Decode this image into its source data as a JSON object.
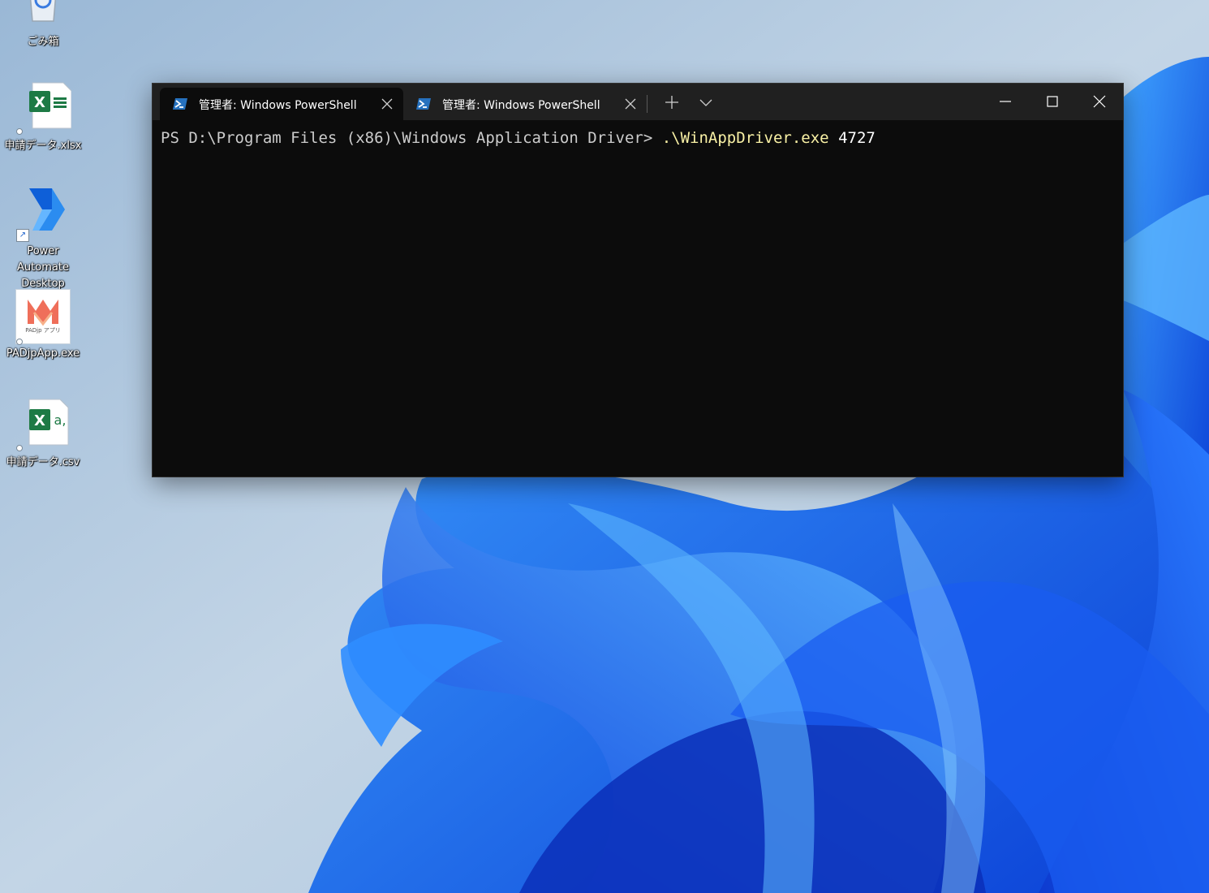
{
  "desktop": {
    "icons": [
      {
        "label": "ごみ箱",
        "icon": "recycle-bin-icon"
      },
      {
        "label": "申請データ.xlsx",
        "icon": "excel-icon"
      },
      {
        "label": "Power Automate\nDesktop",
        "icon": "power-automate-icon"
      },
      {
        "label": "PADjpApp.exe",
        "icon": "padjp-app-icon",
        "icon_text": "PADjp アプリ"
      },
      {
        "label": "申請データ.csv",
        "icon": "excel-csv-icon"
      }
    ]
  },
  "terminal": {
    "tabs": [
      {
        "title": "管理者: Windows PowerShell",
        "active": true,
        "icon": "powershell-icon"
      },
      {
        "title": "管理者: Windows PowerShell",
        "active": false,
        "icon": "powershell-icon"
      }
    ],
    "new_tab_icon": "plus-icon",
    "dropdown_icon": "chevron-down-icon",
    "window_controls": [
      "minimize-icon",
      "maximize-icon",
      "close-icon"
    ],
    "console": {
      "prompt": "PS D:\\Program Files (x86)\\Windows Application Driver> ",
      "command": ".\\WinAppDriver.exe",
      "argument": "4727"
    },
    "colors": {
      "background": "#0c0c0c",
      "titlebar": "#202020",
      "prompt_text": "#cccccc",
      "command_text": "#f9f1a5"
    }
  }
}
